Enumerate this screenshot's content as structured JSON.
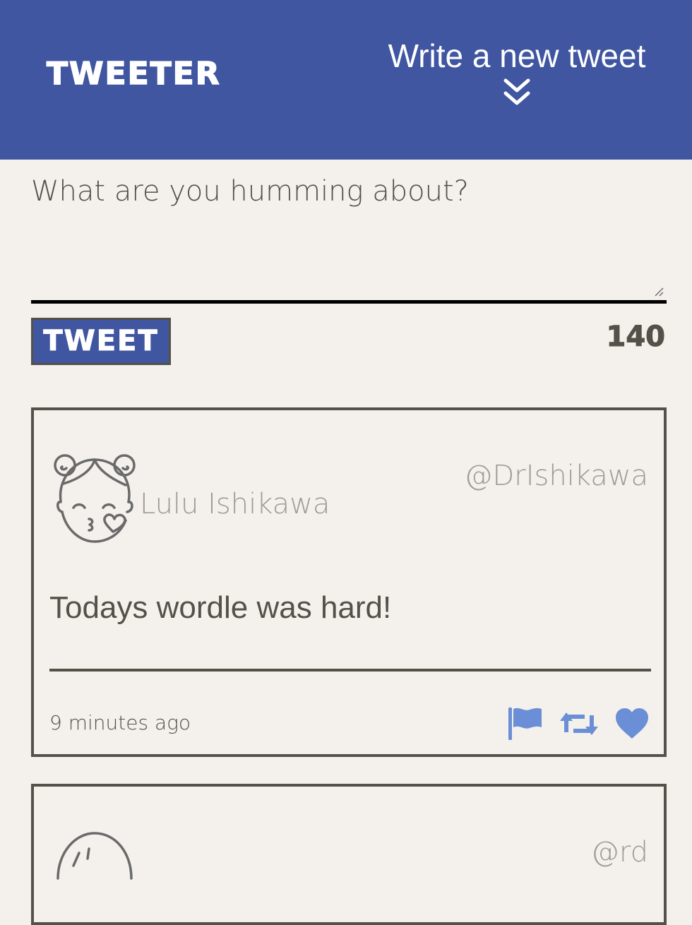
{
  "nav": {
    "brand": "TWEETER",
    "compose_label": "Write a new tweet",
    "compose_icon": "double-chevron-down-icon"
  },
  "composer": {
    "placeholder": "What are you humming about?",
    "submit_label": "TWEET",
    "char_count": "140"
  },
  "tweets": [
    {
      "name": "Lulu Ishikawa",
      "handle": "@DrIshikawa",
      "content": "Todays wordle was hard!",
      "timestamp": "9 minutes ago",
      "avatar_icon": "girl-blowing-kiss-avatar-icon",
      "actions": [
        "flag-icon",
        "retweet-icon",
        "heart-icon"
      ]
    },
    {
      "name": "",
      "handle": "@rd",
      "content": "",
      "timestamp": "",
      "avatar_icon": "avatar-icon"
    }
  ],
  "colors": {
    "nav_background": "#4056a1",
    "page_background": "#f4f1ec",
    "text": "#545149",
    "muted_text": "#9c9c98",
    "action_icon": "#6b8fd6"
  }
}
